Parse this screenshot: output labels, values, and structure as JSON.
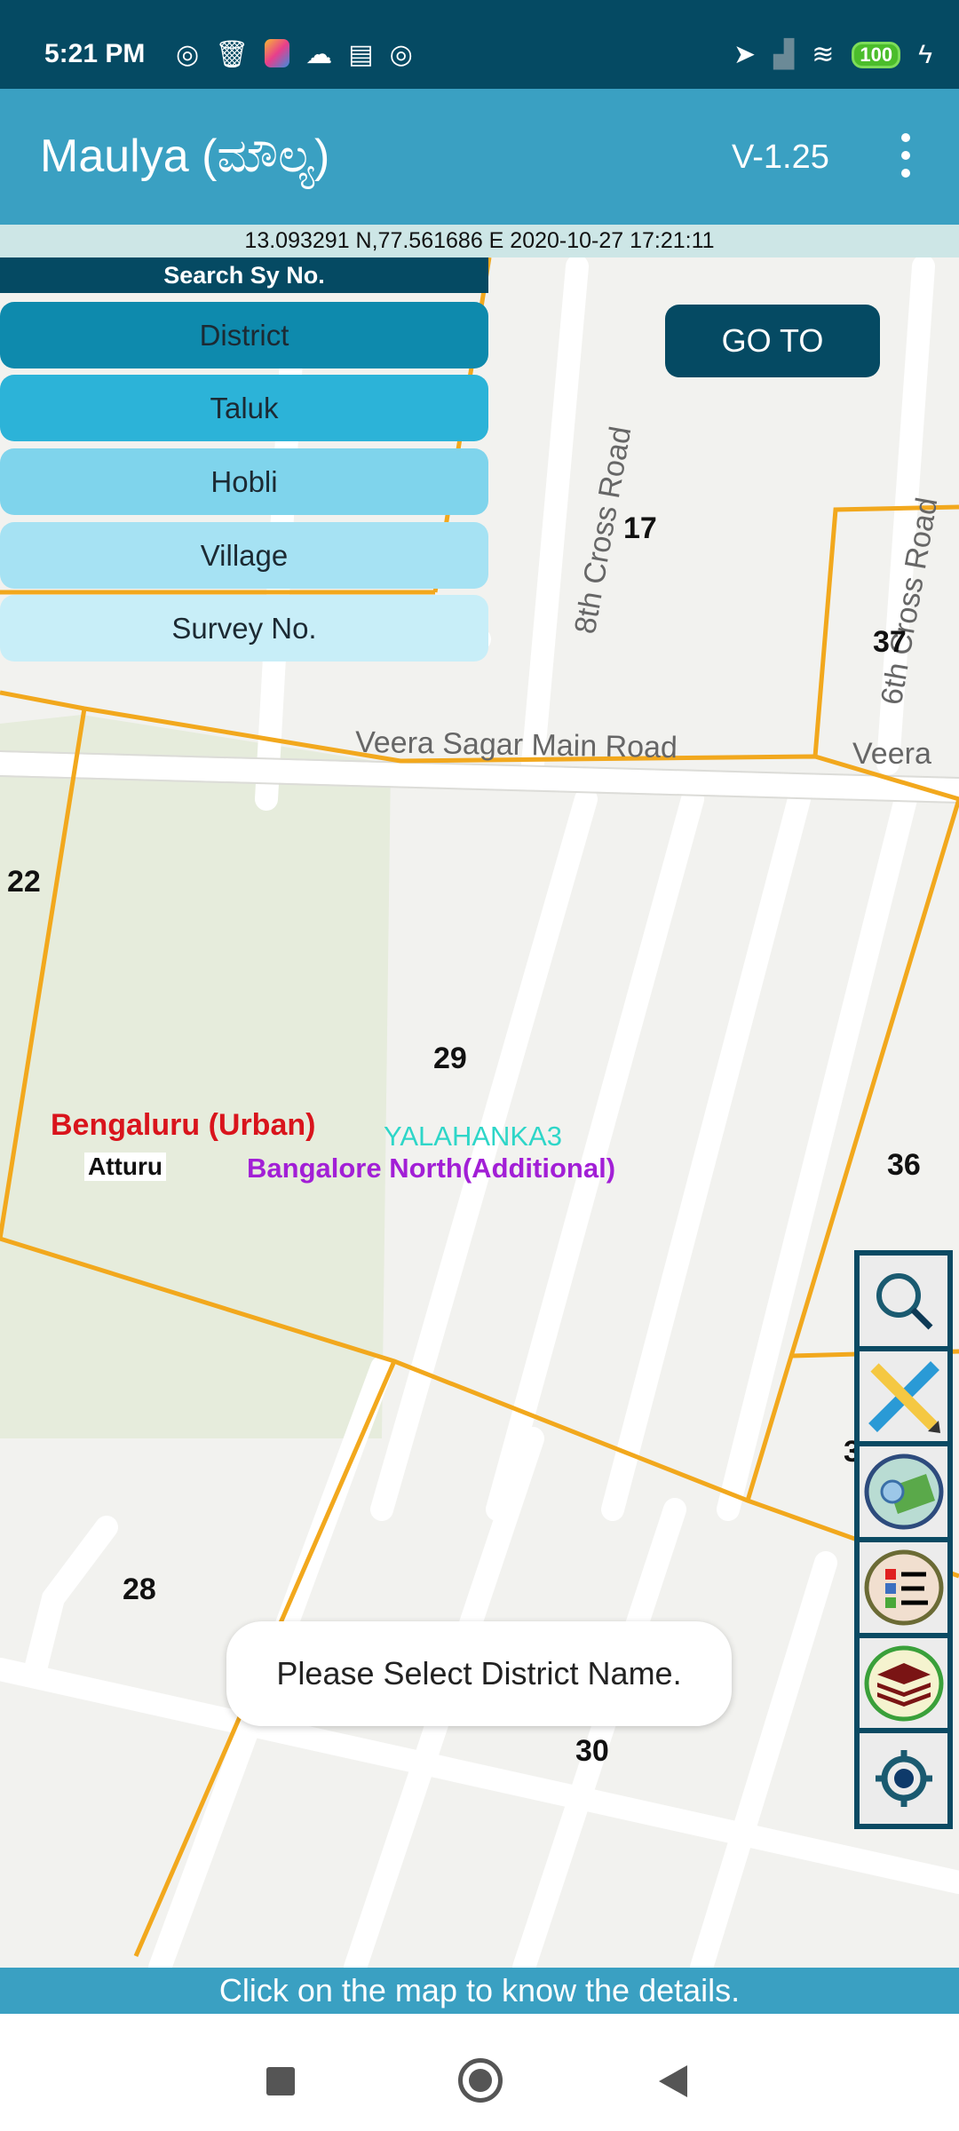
{
  "status_bar": {
    "time": "5:21 PM",
    "left_icons": [
      "sync-icon",
      "trash-icon",
      "app-icon",
      "cloud-icon",
      "calendar-icon",
      "sync-icon"
    ],
    "right_icons": [
      "location-icon",
      "signal-icon",
      "wifi-icon",
      "battery-icon",
      "charging-icon"
    ],
    "battery": "100"
  },
  "app_bar": {
    "title": "Maulya (ಮೌಲ್ಯ)",
    "version": "V-1.25",
    "menu_icon": "more-vert-icon"
  },
  "coord_bar": {
    "text": "13.093291 N,77.561686 E   2020-10-27 17:21:11"
  },
  "search": {
    "header": "Search Sy No.",
    "items": [
      {
        "label": "District",
        "color": "#0e8aad"
      },
      {
        "label": "Taluk",
        "color": "#2cb3d8"
      },
      {
        "label": "Hobli",
        "color": "#7fd4ec"
      },
      {
        "label": "Village",
        "color": "#a6e2f3"
      },
      {
        "label": "Survey No.",
        "color": "#c8eef8"
      }
    ],
    "goto_label": "GO TO"
  },
  "map": {
    "parcels": [
      "17",
      "37",
      "22",
      "29",
      "36",
      "28",
      "30",
      "3"
    ],
    "roads": [
      "8th Cross Road",
      "6th Cross Road",
      "Veera Sagar Main Road",
      "Veera"
    ],
    "district": "Bengaluru (Urban)",
    "hobli": "YALAHANKA3",
    "taluk": "Bangalore North(Additional)",
    "village": "Atturu",
    "district_color": "#d9141c",
    "hobli_color": "#2ed6c8",
    "taluk_color": "#a21fd6",
    "boundary_color": "#f2a81d"
  },
  "tools": [
    "search-zoom-icon",
    "measure-icon",
    "map-search-icon",
    "legend-icon",
    "layers-icon",
    "my-location-icon"
  ],
  "toast": "Please Select District Name.",
  "bottom_bar": "Click on the map to know the details.",
  "nav": [
    "recents-button",
    "home-button",
    "back-button"
  ]
}
